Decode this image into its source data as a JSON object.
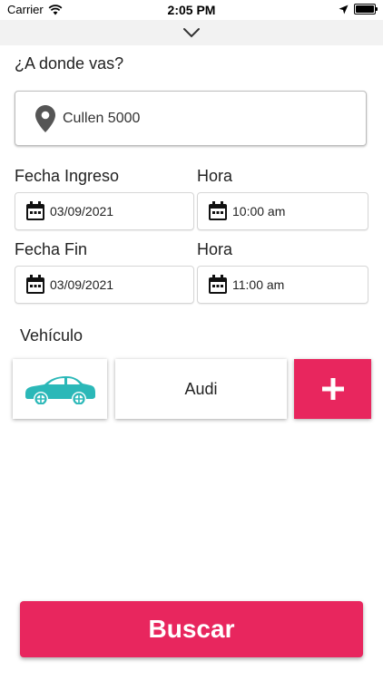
{
  "status_bar": {
    "carrier": "Carrier",
    "time": "2:05 PM"
  },
  "destination": {
    "question": "¿A donde vas?",
    "value": "Cullen 5000"
  },
  "start": {
    "date_label": "Fecha Ingreso",
    "time_label": "Hora",
    "date": "03/09/2021",
    "time": "10:00 am"
  },
  "end": {
    "date_label": "Fecha Fin",
    "time_label": "Hora",
    "date": "03/09/2021",
    "time": "11:00 am"
  },
  "vehicle": {
    "label": "Vehículo",
    "name": "Audi"
  },
  "search_button_label": "Buscar",
  "colors": {
    "accent": "#e8265e",
    "car": "#2bb8b8",
    "icon": "#555555"
  }
}
